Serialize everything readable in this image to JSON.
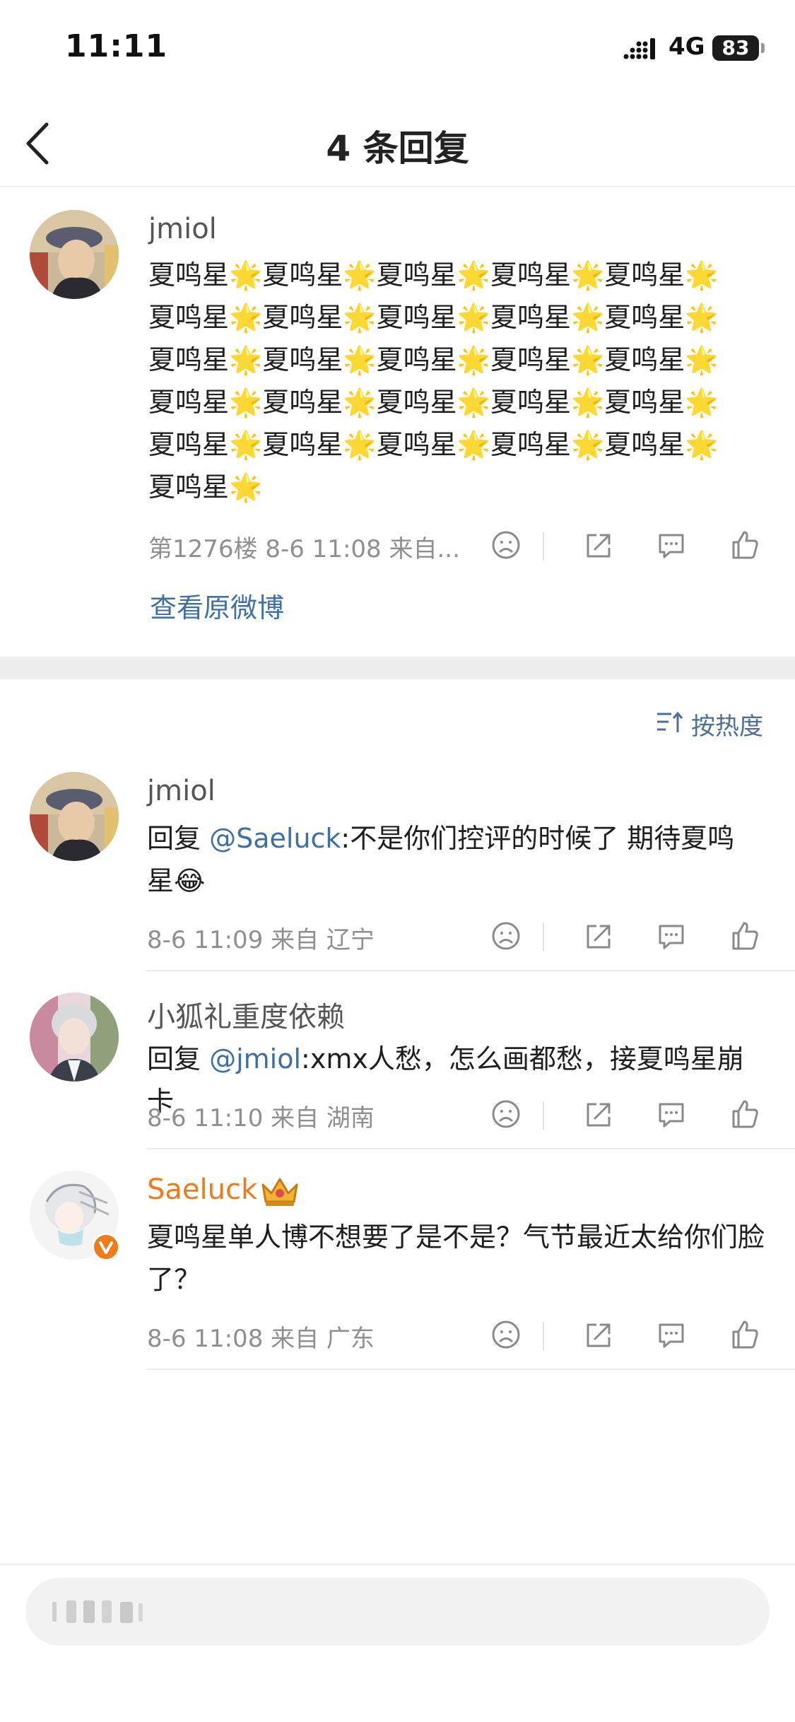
{
  "status_bar": {
    "time": "11:11",
    "network": "4G",
    "battery": "83"
  },
  "nav": {
    "title": "4 条回复"
  },
  "root_comment": {
    "username": "jmiol",
    "text": "夏鸣星🌟夏鸣星🌟夏鸣星🌟夏鸣星🌟夏鸣星🌟夏鸣星🌟夏鸣星🌟夏鸣星🌟夏鸣星🌟夏鸣星🌟夏鸣星🌟夏鸣星🌟夏鸣星🌟夏鸣星🌟夏鸣星🌟夏鸣星🌟夏鸣星🌟夏鸣星🌟夏鸣星🌟夏鸣星🌟夏鸣星🌟夏鸣星🌟夏鸣星🌟夏鸣星🌟夏鸣星🌟夏鸣星🌟",
    "meta": "第1276楼 8-6 11:08  来自...",
    "view_original": "查看原微博"
  },
  "sort": {
    "label": "按热度"
  },
  "replies": [
    {
      "username": "jmiol",
      "reply_prefix": "回复 ",
      "mention": "@Saeluck",
      "text": ":不是你们控评的时候了 期待夏鸣星😂",
      "meta": "8-6 11:09  来自 辽宁"
    },
    {
      "username": "小狐礼重度依赖",
      "reply_prefix": "回复 ",
      "mention": "@jmiol",
      "text": ":xmx人愁，怎么画都愁，接夏鸣星崩卡",
      "meta": "8-6 11:10  来自 湖南"
    },
    {
      "username": "Saeluck",
      "badge_icon": "crown-icon",
      "text": "夏鸣星单人博不想要了是不是？气节最近太给你们脸了？",
      "meta": "8-6 11:08  来自 广东"
    }
  ],
  "colors": {
    "link": "#3f6fa3",
    "vip": "#f07b1a",
    "meta": "#8f8f8f"
  }
}
